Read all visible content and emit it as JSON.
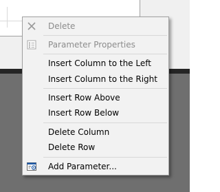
{
  "context_menu": {
    "items": [
      {
        "label": "Delete",
        "enabled": false,
        "icon": "close-icon"
      },
      {
        "label": "Parameter Properties",
        "enabled": false,
        "icon": "properties-icon"
      },
      {
        "label": "Insert Column to the Left",
        "enabled": true
      },
      {
        "label": "Insert Column to the Right",
        "enabled": true
      },
      {
        "label": "Insert Row Above",
        "enabled": true
      },
      {
        "label": "Insert Row Below",
        "enabled": true
      },
      {
        "label": "Delete Column",
        "enabled": true
      },
      {
        "label": "Delete Row",
        "enabled": true
      },
      {
        "label": "Add Parameter...",
        "enabled": true,
        "icon": "add-parameter-icon"
      }
    ]
  },
  "colors": {
    "menu_background": "#f2f2f2",
    "disabled_text": "#8c8c8c",
    "background_dark": "#6f6f6f",
    "icon_accent": "#1e5aa8"
  }
}
